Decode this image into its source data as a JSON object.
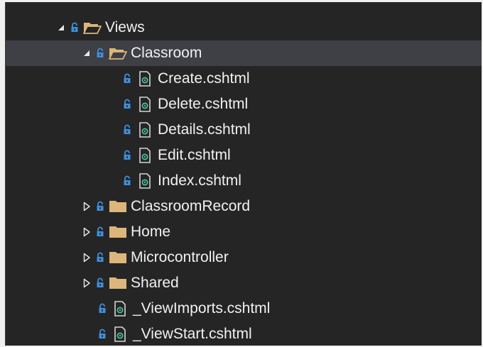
{
  "colors": {
    "panel_bg": "#252526",
    "selection_bg": "#3f3f46",
    "text": "#f1f1f1",
    "folder": "#dcb67a",
    "lock": "#3d8fd9",
    "file_accent": "#4ec9a0"
  },
  "tree": {
    "root": {
      "label": "Views",
      "expanded": true,
      "icon": "folder-open-icon"
    },
    "classroom": {
      "label": "Classroom",
      "expanded": true,
      "selected": true,
      "icon": "folder-open-icon"
    },
    "classroom_files": [
      {
        "label": "Create.cshtml",
        "icon": "razor-file-icon"
      },
      {
        "label": "Delete.cshtml",
        "icon": "razor-file-icon"
      },
      {
        "label": "Details.cshtml",
        "icon": "razor-file-icon"
      },
      {
        "label": "Edit.cshtml",
        "icon": "razor-file-icon"
      },
      {
        "label": "Index.cshtml",
        "icon": "razor-file-icon"
      }
    ],
    "folders": [
      {
        "label": "ClassroomRecord",
        "expanded": false,
        "icon": "folder-closed-icon"
      },
      {
        "label": "Home",
        "expanded": false,
        "icon": "folder-closed-icon"
      },
      {
        "label": "Microcontroller",
        "expanded": false,
        "icon": "folder-closed-icon"
      },
      {
        "label": "Shared",
        "expanded": false,
        "icon": "folder-closed-icon"
      }
    ],
    "root_files": [
      {
        "label": "_ViewImports.cshtml",
        "icon": "razor-file-icon"
      },
      {
        "label": "_ViewStart.cshtml",
        "icon": "razor-file-icon"
      }
    ]
  }
}
